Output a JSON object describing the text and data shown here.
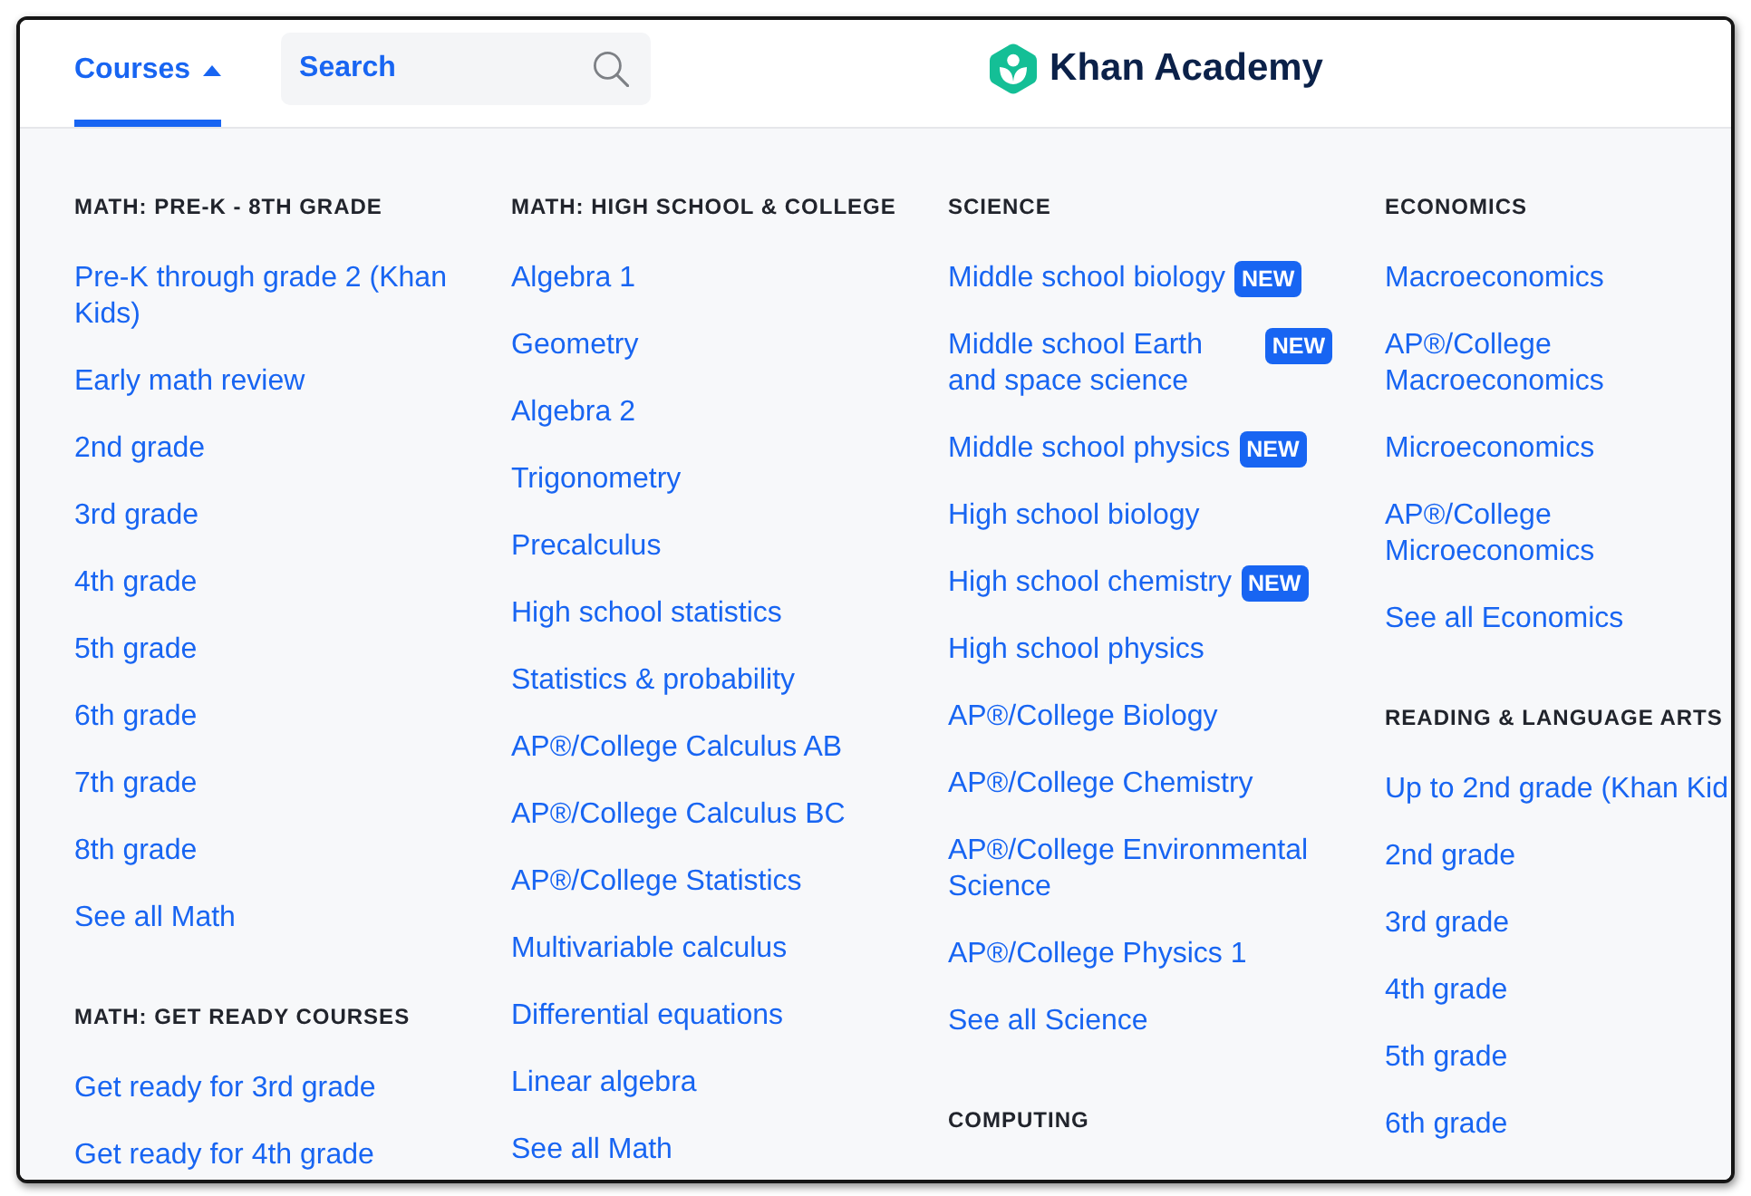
{
  "header": {
    "tabs": [
      {
        "label": "Courses",
        "selected": true,
        "expanded": true
      }
    ],
    "search": {
      "placeholder": "Search"
    },
    "logo": {
      "text": "Khan Academy"
    }
  },
  "menu": {
    "columns": [
      {
        "sections": [
          {
            "heading": "MATH: PRE-K - 8TH GRADE",
            "links": [
              {
                "label": "Pre-K through grade 2 (Khan Kids)"
              },
              {
                "label": "Early math review"
              },
              {
                "label": "2nd grade"
              },
              {
                "label": "3rd grade"
              },
              {
                "label": "4th grade"
              },
              {
                "label": "5th grade"
              },
              {
                "label": "6th grade"
              },
              {
                "label": "7th grade"
              },
              {
                "label": "8th grade"
              },
              {
                "label": "See all Math"
              }
            ]
          },
          {
            "heading": "MATH: GET READY COURSES",
            "links": [
              {
                "label": "Get ready for 3rd grade"
              },
              {
                "label": "Get ready for 4th grade"
              }
            ]
          }
        ]
      },
      {
        "sections": [
          {
            "heading": "MATH: HIGH SCHOOL & COLLEGE",
            "links": [
              {
                "label": "Algebra 1"
              },
              {
                "label": "Geometry"
              },
              {
                "label": "Algebra 2"
              },
              {
                "label": "Trigonometry"
              },
              {
                "label": "Precalculus"
              },
              {
                "label": "High school statistics"
              },
              {
                "label": "Statistics & probability"
              },
              {
                "label": "AP®/College Calculus AB"
              },
              {
                "label": "AP®/College Calculus BC"
              },
              {
                "label": "AP®/College Statistics"
              },
              {
                "label": "Multivariable calculus"
              },
              {
                "label": "Differential equations"
              },
              {
                "label": "Linear algebra"
              },
              {
                "label": "See all Math"
              }
            ]
          }
        ]
      },
      {
        "sections": [
          {
            "heading": "SCIENCE",
            "links": [
              {
                "label": "Middle school biology",
                "badge": "NEW"
              },
              {
                "label": "Middle school Earth and space science",
                "badge": "NEW"
              },
              {
                "label": "Middle school physics",
                "badge": "NEW"
              },
              {
                "label": "High school biology"
              },
              {
                "label": "High school chemistry",
                "badge": "NEW"
              },
              {
                "label": "High school physics"
              },
              {
                "label": "AP®/College Biology"
              },
              {
                "label": "AP®/College Chemistry"
              },
              {
                "label": "AP®/College Environmental Science"
              },
              {
                "label": "AP®/College Physics 1"
              },
              {
                "label": "See all Science"
              }
            ]
          },
          {
            "heading": "COMPUTING"
          }
        ]
      },
      {
        "sections": [
          {
            "heading": "ECONOMICS",
            "links": [
              {
                "label": "Macroeconomics"
              },
              {
                "label": "AP®/College Macroeconomics"
              },
              {
                "label": "Microeconomics"
              },
              {
                "label": "AP®/College Microeconomics"
              },
              {
                "label": "See all Economics"
              }
            ]
          },
          {
            "heading": "READING & LANGUAGE ARTS",
            "links": [
              {
                "label": "Up to 2nd grade (Khan Kid"
              },
              {
                "label": "2nd grade"
              },
              {
                "label": "3rd grade"
              },
              {
                "label": "4th grade"
              },
              {
                "label": "5th grade"
              },
              {
                "label": "6th grade"
              }
            ]
          }
        ]
      }
    ]
  }
}
